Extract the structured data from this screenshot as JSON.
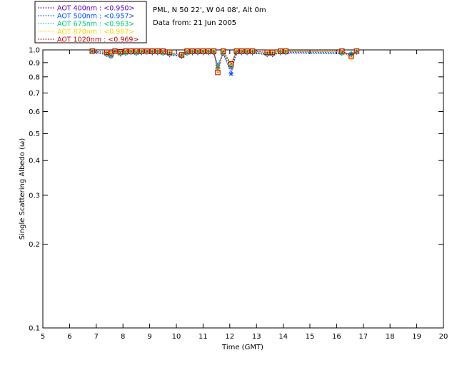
{
  "chart_data": {
    "type": "scatter",
    "title_lines": [
      "PML, N 50 22', W 04 08', Alt 0m",
      "Data from: 21 Jun 2005"
    ],
    "xlabel": "Time (GMT)",
    "ylabel": "Single Scattering Albedo (ω)",
    "xlim": [
      5,
      20
    ],
    "ylim": [
      0.1,
      1.0
    ],
    "yscale": "log",
    "x_ticks": [
      5,
      6,
      7,
      8,
      9,
      10,
      11,
      12,
      13,
      14,
      15,
      16,
      17,
      18,
      19,
      20
    ],
    "y_ticks": [
      0.1,
      0.2,
      0.3,
      0.4,
      0.5,
      0.6,
      0.7,
      0.8,
      0.9,
      1.0
    ],
    "y_tick_labels": [
      "0.1",
      "0.2",
      "0.3",
      "0.4",
      "0.5",
      "0.6",
      "0.7",
      "0.8",
      "0.9",
      "1.0"
    ],
    "legend_position": "top-left",
    "series": [
      {
        "name": "AOT  400nm : <0.950>",
        "color": "#5a00b4",
        "marker": "plus",
        "x": [
          6.85,
          7.4,
          7.55,
          7.7,
          7.9,
          8.1,
          8.3,
          8.5,
          8.7,
          8.9,
          9.1,
          9.3,
          9.5,
          9.75,
          10.2,
          10.4,
          10.6,
          10.8,
          11.0,
          11.2,
          11.4,
          11.55,
          11.75,
          12.05,
          12.25,
          12.45,
          12.65,
          12.85,
          13.4,
          13.6,
          13.9,
          14.1,
          16.2,
          16.55,
          16.75
        ],
        "y": [
          0.985,
          0.96,
          0.945,
          0.985,
          0.965,
          0.97,
          0.975,
          0.97,
          0.975,
          0.98,
          0.975,
          0.975,
          0.97,
          0.96,
          0.945,
          0.97,
          0.975,
          0.975,
          0.975,
          0.975,
          0.975,
          0.86,
          0.97,
          0.86,
          0.975,
          0.975,
          0.975,
          0.975,
          0.96,
          0.96,
          0.975,
          0.975,
          0.97,
          0.96,
          0.98
        ]
      },
      {
        "name": "AOT  500nm : <0.957>",
        "color": "#0050ff",
        "marker": "asterisk",
        "x": [
          6.85,
          7.4,
          7.55,
          7.7,
          7.9,
          8.1,
          8.3,
          8.5,
          8.7,
          8.9,
          9.1,
          9.3,
          9.5,
          9.75,
          10.2,
          10.4,
          10.6,
          10.8,
          11.0,
          11.2,
          11.4,
          11.55,
          11.75,
          12.05,
          12.25,
          12.45,
          12.65,
          12.85,
          13.4,
          13.6,
          13.9,
          14.1,
          16.2,
          16.55,
          16.75
        ],
        "y": [
          0.99,
          0.965,
          0.95,
          0.99,
          0.97,
          0.975,
          0.98,
          0.975,
          0.98,
          0.985,
          0.98,
          0.98,
          0.975,
          0.965,
          0.95,
          0.975,
          0.98,
          0.98,
          0.98,
          0.98,
          0.98,
          0.88,
          0.975,
          0.82,
          0.98,
          0.98,
          0.98,
          0.98,
          0.965,
          0.965,
          0.98,
          0.98,
          0.975,
          0.965,
          0.985
        ]
      },
      {
        "name": "AOT  675nm : <0.963>",
        "color": "#00c878",
        "marker": "triangle",
        "x": [
          6.85,
          7.4,
          7.55,
          7.7,
          7.9,
          8.1,
          8.3,
          8.5,
          8.7,
          8.9,
          9.1,
          9.3,
          9.5,
          9.75,
          10.2,
          10.4,
          10.6,
          10.8,
          11.0,
          11.2,
          11.4,
          11.55,
          11.75,
          12.05,
          12.25,
          12.45,
          12.65,
          12.85,
          13.4,
          13.6,
          13.9,
          14.1,
          16.2,
          16.55,
          16.75
        ],
        "y": [
          0.99,
          0.97,
          0.96,
          0.99,
          0.975,
          0.98,
          0.985,
          0.98,
          0.985,
          0.99,
          0.985,
          0.985,
          0.98,
          0.97,
          0.955,
          0.98,
          0.985,
          0.985,
          0.985,
          0.985,
          0.985,
          0.87,
          0.98,
          0.88,
          0.985,
          0.985,
          0.985,
          0.985,
          0.97,
          0.97,
          0.985,
          0.985,
          0.98,
          0.97,
          0.99
        ]
      },
      {
        "name": "AOT  870nm : <0.967>",
        "color": "#ffd200",
        "marker": "diamond",
        "x": [
          6.85,
          7.4,
          7.55,
          7.7,
          7.9,
          8.1,
          8.3,
          8.5,
          8.7,
          8.9,
          9.1,
          9.3,
          9.5,
          9.75,
          10.2,
          10.4,
          10.6,
          10.8,
          11.0,
          11.2,
          11.4,
          11.55,
          11.75,
          12.05,
          12.25,
          12.45,
          12.65,
          12.85,
          13.4,
          13.6,
          13.9,
          14.1,
          16.2,
          16.55,
          16.75
        ],
        "y": [
          0.99,
          0.975,
          0.965,
          0.99,
          0.98,
          0.985,
          0.99,
          0.985,
          0.99,
          0.99,
          0.99,
          0.99,
          0.985,
          0.975,
          0.96,
          0.985,
          0.99,
          0.99,
          0.99,
          0.99,
          0.99,
          0.84,
          0.985,
          0.89,
          0.99,
          0.99,
          0.99,
          0.99,
          0.975,
          0.975,
          0.99,
          0.99,
          0.985,
          0.935,
          0.99
        ]
      },
      {
        "name": "AOT 1020nm : <0.969>",
        "color": "#c80000",
        "marker": "square",
        "x": [
          6.85,
          7.4,
          7.55,
          7.7,
          7.9,
          8.1,
          8.3,
          8.5,
          8.7,
          8.9,
          9.1,
          9.3,
          9.5,
          9.75,
          10.2,
          10.4,
          10.6,
          10.8,
          11.0,
          11.2,
          11.4,
          11.55,
          11.75,
          12.05,
          12.25,
          12.45,
          12.65,
          12.85,
          13.4,
          13.6,
          13.9,
          14.1,
          16.2,
          16.55,
          16.75
        ],
        "y": [
          0.99,
          0.98,
          0.97,
          0.99,
          0.985,
          0.99,
          0.99,
          0.99,
          0.99,
          0.99,
          0.99,
          0.99,
          0.99,
          0.98,
          0.96,
          0.99,
          0.99,
          0.99,
          0.99,
          0.99,
          0.99,
          0.83,
          0.99,
          0.89,
          0.99,
          0.99,
          0.99,
          0.99,
          0.98,
          0.98,
          0.99,
          0.99,
          0.99,
          0.95,
          0.99
        ]
      }
    ]
  }
}
